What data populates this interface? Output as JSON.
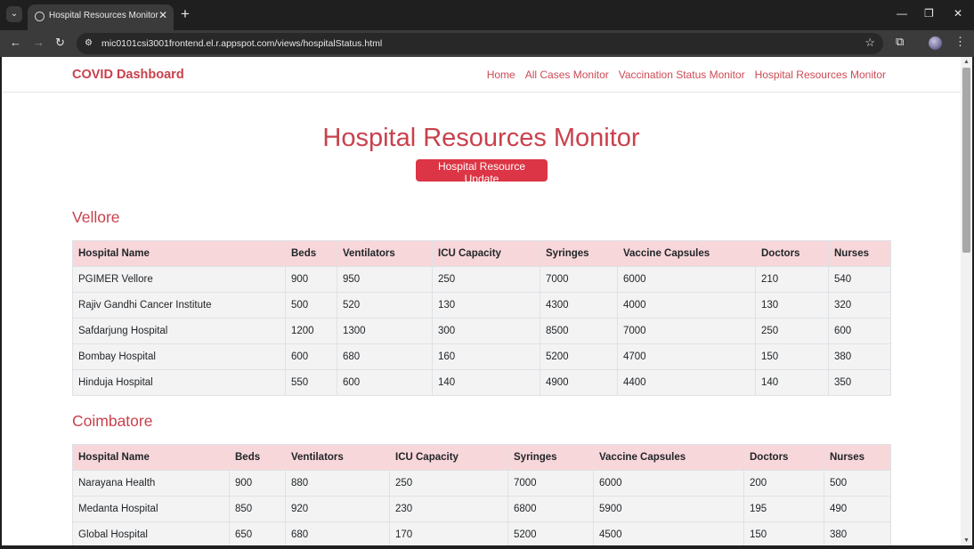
{
  "browser": {
    "tab_title": "Hospital Resources Monitor",
    "url": "mic0101csi3001frontend.el.r.appspot.com/views/hospitalStatus.html"
  },
  "site": {
    "brand": "COVID Dashboard",
    "nav": [
      "Home",
      "All Cases Monitor",
      "Vaccination Status Monitor",
      "Hospital Resources Monitor"
    ],
    "title": "Hospital Resources Monitor",
    "update_button": "Hospital Resource Update"
  },
  "sections": [
    {
      "city": "Vellore",
      "columns": [
        "Hospital Name",
        "Beds",
        "Ventilators",
        "ICU Capacity",
        "Syringes",
        "Vaccine Capsules",
        "Doctors",
        "Nurses"
      ],
      "rows": [
        [
          "PGIMER Vellore",
          "900",
          "950",
          "250",
          "7000",
          "6000",
          "210",
          "540"
        ],
        [
          "Rajiv Gandhi Cancer Institute",
          "500",
          "520",
          "130",
          "4300",
          "4000",
          "130",
          "320"
        ],
        [
          "Safdarjung Hospital",
          "1200",
          "1300",
          "300",
          "8500",
          "7000",
          "250",
          "600"
        ],
        [
          "Bombay Hospital",
          "600",
          "680",
          "160",
          "5200",
          "4700",
          "150",
          "380"
        ],
        [
          "Hinduja Hospital",
          "550",
          "600",
          "140",
          "4900",
          "4400",
          "140",
          "350"
        ]
      ]
    },
    {
      "city": "Coimbatore",
      "columns": [
        "Hospital Name",
        "Beds",
        "Ventilators",
        "ICU Capacity",
        "Syringes",
        "Vaccine Capsules",
        "Doctors",
        "Nurses"
      ],
      "rows": [
        [
          "Narayana Health",
          "900",
          "880",
          "250",
          "7000",
          "6000",
          "200",
          "500"
        ],
        [
          "Medanta Hospital",
          "850",
          "920",
          "230",
          "6800",
          "5900",
          "195",
          "490"
        ],
        [
          "Global Hospital",
          "650",
          "680",
          "170",
          "5200",
          "4500",
          "150",
          "380"
        ]
      ]
    }
  ],
  "colors": {
    "accent": "#dc3545",
    "header_bg": "#f8d7da",
    "row_bg": "#f3f3f3"
  }
}
